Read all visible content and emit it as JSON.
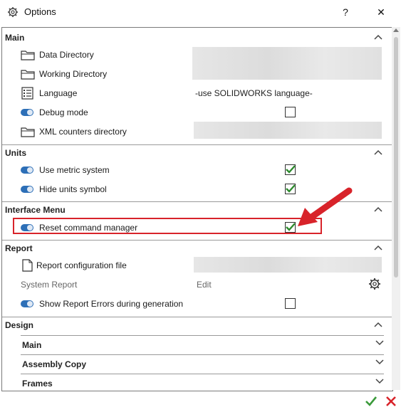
{
  "window": {
    "title": "Options",
    "help": "?",
    "close": "✕"
  },
  "sections": {
    "main": {
      "title": "Main",
      "data_directory": "Data Directory",
      "working_directory": "Working Directory",
      "language": "Language",
      "language_value": "-use SOLIDWORKS language-",
      "debug_mode": "Debug mode",
      "xml_counters": "XML counters directory"
    },
    "units": {
      "title": "Units",
      "use_metric": "Use metric system",
      "hide_units": "Hide units symbol"
    },
    "interface_menu": {
      "title": "Interface Menu",
      "reset_cmd": "Reset command manager"
    },
    "report": {
      "title": "Report",
      "config_file": "Report configuration file",
      "system_report": "System Report",
      "edit": "Edit",
      "show_errors": "Show Report Errors during generation"
    },
    "design": {
      "title": "Design",
      "sub_main": "Main",
      "assembly_copy": "Assembly Copy",
      "frames": "Frames"
    }
  },
  "checkboxes": {
    "debug_mode": false,
    "use_metric": true,
    "hide_units": true,
    "reset_cmd": true,
    "show_errors": false
  },
  "colors": {
    "accent": "#2d6fb7",
    "check": "#2e8b2e",
    "highlight": "#d8232a",
    "ok": "#3a9a3a",
    "cancel": "#d8232a"
  }
}
